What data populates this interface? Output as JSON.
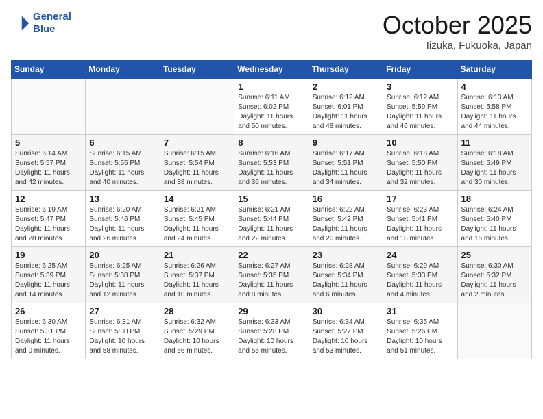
{
  "header": {
    "logo_line1": "General",
    "logo_line2": "Blue",
    "month": "October 2025",
    "location": "Iizuka, Fukuoka, Japan"
  },
  "weekdays": [
    "Sunday",
    "Monday",
    "Tuesday",
    "Wednesday",
    "Thursday",
    "Friday",
    "Saturday"
  ],
  "weeks": [
    [
      {
        "day": "",
        "info": ""
      },
      {
        "day": "",
        "info": ""
      },
      {
        "day": "",
        "info": ""
      },
      {
        "day": "1",
        "info": "Sunrise: 6:11 AM\nSunset: 6:02 PM\nDaylight: 11 hours\nand 50 minutes."
      },
      {
        "day": "2",
        "info": "Sunrise: 6:12 AM\nSunset: 6:01 PM\nDaylight: 11 hours\nand 48 minutes."
      },
      {
        "day": "3",
        "info": "Sunrise: 6:12 AM\nSunset: 5:59 PM\nDaylight: 11 hours\nand 46 minutes."
      },
      {
        "day": "4",
        "info": "Sunrise: 6:13 AM\nSunset: 5:58 PM\nDaylight: 11 hours\nand 44 minutes."
      }
    ],
    [
      {
        "day": "5",
        "info": "Sunrise: 6:14 AM\nSunset: 5:57 PM\nDaylight: 11 hours\nand 42 minutes."
      },
      {
        "day": "6",
        "info": "Sunrise: 6:15 AM\nSunset: 5:55 PM\nDaylight: 11 hours\nand 40 minutes."
      },
      {
        "day": "7",
        "info": "Sunrise: 6:15 AM\nSunset: 5:54 PM\nDaylight: 11 hours\nand 38 minutes."
      },
      {
        "day": "8",
        "info": "Sunrise: 6:16 AM\nSunset: 5:53 PM\nDaylight: 11 hours\nand 36 minutes."
      },
      {
        "day": "9",
        "info": "Sunrise: 6:17 AM\nSunset: 5:51 PM\nDaylight: 11 hours\nand 34 minutes."
      },
      {
        "day": "10",
        "info": "Sunrise: 6:18 AM\nSunset: 5:50 PM\nDaylight: 11 hours\nand 32 minutes."
      },
      {
        "day": "11",
        "info": "Sunrise: 6:18 AM\nSunset: 5:49 PM\nDaylight: 11 hours\nand 30 minutes."
      }
    ],
    [
      {
        "day": "12",
        "info": "Sunrise: 6:19 AM\nSunset: 5:47 PM\nDaylight: 11 hours\nand 28 minutes."
      },
      {
        "day": "13",
        "info": "Sunrise: 6:20 AM\nSunset: 5:46 PM\nDaylight: 11 hours\nand 26 minutes."
      },
      {
        "day": "14",
        "info": "Sunrise: 6:21 AM\nSunset: 5:45 PM\nDaylight: 11 hours\nand 24 minutes."
      },
      {
        "day": "15",
        "info": "Sunrise: 6:21 AM\nSunset: 5:44 PM\nDaylight: 11 hours\nand 22 minutes."
      },
      {
        "day": "16",
        "info": "Sunrise: 6:22 AM\nSunset: 5:42 PM\nDaylight: 11 hours\nand 20 minutes."
      },
      {
        "day": "17",
        "info": "Sunrise: 6:23 AM\nSunset: 5:41 PM\nDaylight: 11 hours\nand 18 minutes."
      },
      {
        "day": "18",
        "info": "Sunrise: 6:24 AM\nSunset: 5:40 PM\nDaylight: 11 hours\nand 16 minutes."
      }
    ],
    [
      {
        "day": "19",
        "info": "Sunrise: 6:25 AM\nSunset: 5:39 PM\nDaylight: 11 hours\nand 14 minutes."
      },
      {
        "day": "20",
        "info": "Sunrise: 6:25 AM\nSunset: 5:38 PM\nDaylight: 11 hours\nand 12 minutes."
      },
      {
        "day": "21",
        "info": "Sunrise: 6:26 AM\nSunset: 5:37 PM\nDaylight: 11 hours\nand 10 minutes."
      },
      {
        "day": "22",
        "info": "Sunrise: 6:27 AM\nSunset: 5:35 PM\nDaylight: 11 hours\nand 8 minutes."
      },
      {
        "day": "23",
        "info": "Sunrise: 6:28 AM\nSunset: 5:34 PM\nDaylight: 11 hours\nand 6 minutes."
      },
      {
        "day": "24",
        "info": "Sunrise: 6:29 AM\nSunset: 5:33 PM\nDaylight: 11 hours\nand 4 minutes."
      },
      {
        "day": "25",
        "info": "Sunrise: 6:30 AM\nSunset: 5:32 PM\nDaylight: 11 hours\nand 2 minutes."
      }
    ],
    [
      {
        "day": "26",
        "info": "Sunrise: 6:30 AM\nSunset: 5:31 PM\nDaylight: 11 hours\nand 0 minutes."
      },
      {
        "day": "27",
        "info": "Sunrise: 6:31 AM\nSunset: 5:30 PM\nDaylight: 10 hours\nand 58 minutes."
      },
      {
        "day": "28",
        "info": "Sunrise: 6:32 AM\nSunset: 5:29 PM\nDaylight: 10 hours\nand 56 minutes."
      },
      {
        "day": "29",
        "info": "Sunrise: 6:33 AM\nSunset: 5:28 PM\nDaylight: 10 hours\nand 55 minutes."
      },
      {
        "day": "30",
        "info": "Sunrise: 6:34 AM\nSunset: 5:27 PM\nDaylight: 10 hours\nand 53 minutes."
      },
      {
        "day": "31",
        "info": "Sunrise: 6:35 AM\nSunset: 5:26 PM\nDaylight: 10 hours\nand 51 minutes."
      },
      {
        "day": "",
        "info": ""
      }
    ]
  ]
}
